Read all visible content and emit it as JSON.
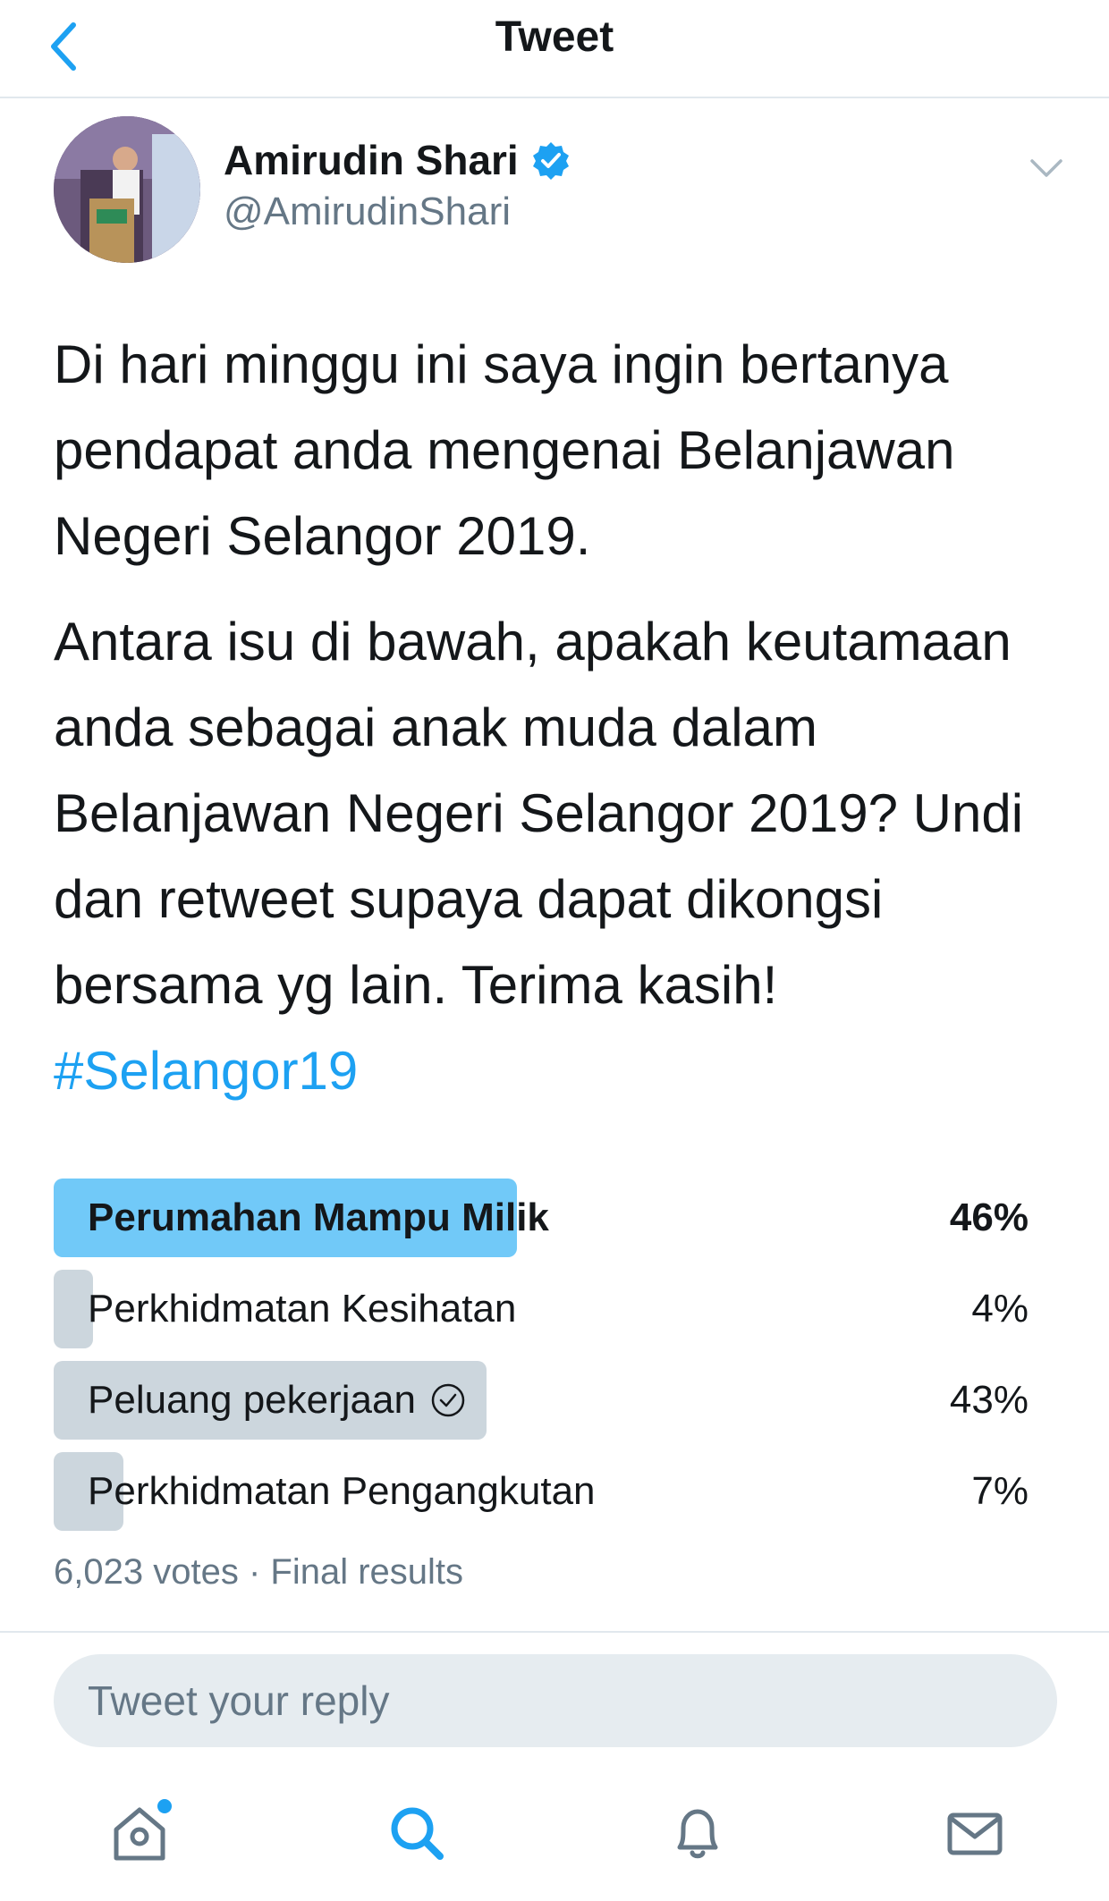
{
  "header": {
    "title": "Tweet",
    "back_icon": "chevron-left-icon"
  },
  "author": {
    "name": "Amirudin Shari",
    "handle": "@AmirudinShari",
    "verified": true,
    "verified_color": "#1da1f2"
  },
  "tweet": {
    "paragraphs": [
      "Di hari minggu ini saya ingin bertanya pendapat anda mengenai Belanjawan Negeri Selangor 2019.",
      "Antara isu di bawah, apakah keutamaan anda sebagai anak muda dalam Belanjawan Negeri Selangor 2019? Undi dan retweet supaya dapat dikongsi bersama yg lain. Terima kasih!"
    ],
    "hashtag": "#Selangor19"
  },
  "poll": {
    "options": [
      {
        "label": "Perumahan Mampu Milik",
        "percent_text": "46%",
        "percent": 46,
        "winner": true,
        "voted": false
      },
      {
        "label": "Perkhidmatan Kesihatan",
        "percent_text": "4%",
        "percent": 4,
        "winner": false,
        "voted": false
      },
      {
        "label": "Peluang pekerjaan",
        "percent_text": "43%",
        "percent": 43,
        "winner": false,
        "voted": true
      },
      {
        "label": "Perkhidmatan Pengangkutan",
        "percent_text": "7%",
        "percent": 7,
        "winner": false,
        "voted": false
      }
    ],
    "votes": "6,023 votes",
    "separator": "·",
    "status": "Final results"
  },
  "reply": {
    "placeholder": "Tweet your reply"
  },
  "tabbar": {
    "items": [
      "home-icon",
      "search-icon",
      "bell-icon",
      "mail-icon"
    ],
    "home_has_notification": true,
    "accent": "#1da1f2",
    "icon_color": "#657786"
  }
}
